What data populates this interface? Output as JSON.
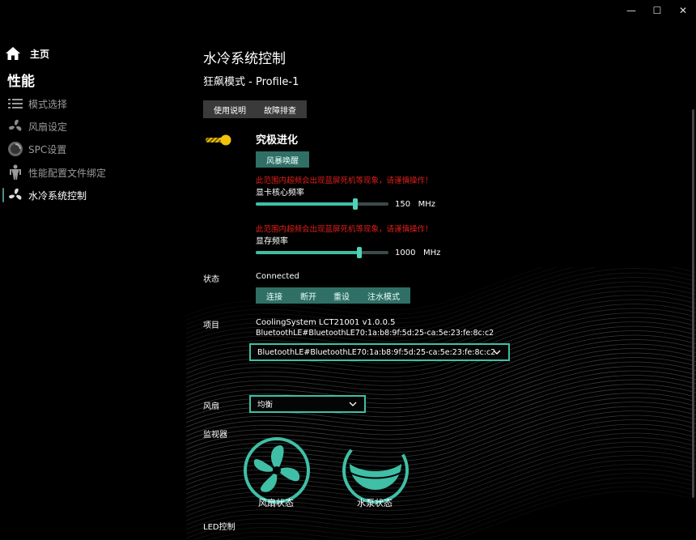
{
  "window": {
    "minimize_glyph": "—",
    "maximize_glyph": "☐",
    "close_glyph": "✕"
  },
  "sidebar": {
    "home_label": "主页",
    "section_title": "性能",
    "items": [
      {
        "label": "模式选择",
        "icon": "list-icon"
      },
      {
        "label": "风扇设定",
        "icon": "fan-icon"
      },
      {
        "label": "SPC设置",
        "icon": "disc-icon"
      },
      {
        "label": "性能配置文件绑定",
        "icon": "figure-icon"
      },
      {
        "label": "水冷系统控制",
        "icon": "fan-icon"
      }
    ]
  },
  "main": {
    "title": "水冷系统控制",
    "subtitle": "狂飙模式 - Profile-1",
    "manual_button": "使用说明",
    "troubleshoot_button": "故障排查",
    "toggle_label": "究极进化",
    "storm_button": "风暴唤醒",
    "gpu": {
      "warning": "此范围内超频会出现蓝屏死机等现象，请谨慎操作！",
      "label": "显卡核心频率",
      "value": "150",
      "unit": "MHz",
      "fraction": 0.75
    },
    "vram": {
      "warning": "此范围内超频会出现蓝屏死机等现象，请谨慎操作！",
      "label": "显存频率",
      "value": "1000",
      "unit": "MHz",
      "fraction": 0.78
    },
    "status_label": "状态",
    "status_value": "Connected",
    "action_buttons": [
      "连接",
      "断开",
      "重设",
      "注水模式"
    ],
    "project_label": "项目",
    "project_line1": "CoolingSystem LCT21001 v1.0.0.5",
    "project_line2": "BluetoothLE#BluetoothLE70:1a:b8:9f:5d:25-ca:5e:23:fe:8c:c2",
    "device_select": "BluetoothLE#BluetoothLE70:1a:b8:9f:5d:25-ca:5e:23:fe:8c:c2",
    "fan_label": "风扇",
    "fan_select": "均衡",
    "monitor_label": "监视器",
    "fan_status": "风扇状态",
    "pump_status": "水泵状态",
    "led_label": "LED控制"
  },
  "colors": {
    "accent": "#3fbfa6",
    "toggle": "#f2c20c",
    "warning": "#e0201a"
  }
}
